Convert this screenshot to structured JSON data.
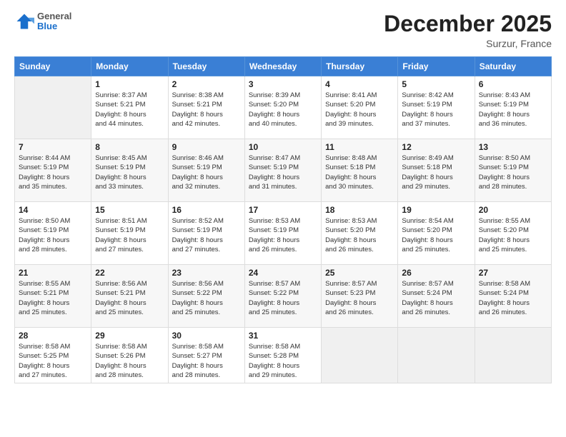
{
  "header": {
    "logo_general": "General",
    "logo_blue": "Blue",
    "month_title": "December 2025",
    "location": "Surzur, France"
  },
  "days_of_week": [
    "Sunday",
    "Monday",
    "Tuesday",
    "Wednesday",
    "Thursday",
    "Friday",
    "Saturday"
  ],
  "weeks": [
    [
      {
        "day": "",
        "info": ""
      },
      {
        "day": "1",
        "info": "Sunrise: 8:37 AM\nSunset: 5:21 PM\nDaylight: 8 hours\nand 44 minutes."
      },
      {
        "day": "2",
        "info": "Sunrise: 8:38 AM\nSunset: 5:21 PM\nDaylight: 8 hours\nand 42 minutes."
      },
      {
        "day": "3",
        "info": "Sunrise: 8:39 AM\nSunset: 5:20 PM\nDaylight: 8 hours\nand 40 minutes."
      },
      {
        "day": "4",
        "info": "Sunrise: 8:41 AM\nSunset: 5:20 PM\nDaylight: 8 hours\nand 39 minutes."
      },
      {
        "day": "5",
        "info": "Sunrise: 8:42 AM\nSunset: 5:19 PM\nDaylight: 8 hours\nand 37 minutes."
      },
      {
        "day": "6",
        "info": "Sunrise: 8:43 AM\nSunset: 5:19 PM\nDaylight: 8 hours\nand 36 minutes."
      }
    ],
    [
      {
        "day": "7",
        "info": "Sunrise: 8:44 AM\nSunset: 5:19 PM\nDaylight: 8 hours\nand 35 minutes."
      },
      {
        "day": "8",
        "info": "Sunrise: 8:45 AM\nSunset: 5:19 PM\nDaylight: 8 hours\nand 33 minutes."
      },
      {
        "day": "9",
        "info": "Sunrise: 8:46 AM\nSunset: 5:19 PM\nDaylight: 8 hours\nand 32 minutes."
      },
      {
        "day": "10",
        "info": "Sunrise: 8:47 AM\nSunset: 5:19 PM\nDaylight: 8 hours\nand 31 minutes."
      },
      {
        "day": "11",
        "info": "Sunrise: 8:48 AM\nSunset: 5:18 PM\nDaylight: 8 hours\nand 30 minutes."
      },
      {
        "day": "12",
        "info": "Sunrise: 8:49 AM\nSunset: 5:18 PM\nDaylight: 8 hours\nand 29 minutes."
      },
      {
        "day": "13",
        "info": "Sunrise: 8:50 AM\nSunset: 5:19 PM\nDaylight: 8 hours\nand 28 minutes."
      }
    ],
    [
      {
        "day": "14",
        "info": "Sunrise: 8:50 AM\nSunset: 5:19 PM\nDaylight: 8 hours\nand 28 minutes."
      },
      {
        "day": "15",
        "info": "Sunrise: 8:51 AM\nSunset: 5:19 PM\nDaylight: 8 hours\nand 27 minutes."
      },
      {
        "day": "16",
        "info": "Sunrise: 8:52 AM\nSunset: 5:19 PM\nDaylight: 8 hours\nand 27 minutes."
      },
      {
        "day": "17",
        "info": "Sunrise: 8:53 AM\nSunset: 5:19 PM\nDaylight: 8 hours\nand 26 minutes."
      },
      {
        "day": "18",
        "info": "Sunrise: 8:53 AM\nSunset: 5:20 PM\nDaylight: 8 hours\nand 26 minutes."
      },
      {
        "day": "19",
        "info": "Sunrise: 8:54 AM\nSunset: 5:20 PM\nDaylight: 8 hours\nand 25 minutes."
      },
      {
        "day": "20",
        "info": "Sunrise: 8:55 AM\nSunset: 5:20 PM\nDaylight: 8 hours\nand 25 minutes."
      }
    ],
    [
      {
        "day": "21",
        "info": "Sunrise: 8:55 AM\nSunset: 5:21 PM\nDaylight: 8 hours\nand 25 minutes."
      },
      {
        "day": "22",
        "info": "Sunrise: 8:56 AM\nSunset: 5:21 PM\nDaylight: 8 hours\nand 25 minutes."
      },
      {
        "day": "23",
        "info": "Sunrise: 8:56 AM\nSunset: 5:22 PM\nDaylight: 8 hours\nand 25 minutes."
      },
      {
        "day": "24",
        "info": "Sunrise: 8:57 AM\nSunset: 5:22 PM\nDaylight: 8 hours\nand 25 minutes."
      },
      {
        "day": "25",
        "info": "Sunrise: 8:57 AM\nSunset: 5:23 PM\nDaylight: 8 hours\nand 26 minutes."
      },
      {
        "day": "26",
        "info": "Sunrise: 8:57 AM\nSunset: 5:24 PM\nDaylight: 8 hours\nand 26 minutes."
      },
      {
        "day": "27",
        "info": "Sunrise: 8:58 AM\nSunset: 5:24 PM\nDaylight: 8 hours\nand 26 minutes."
      }
    ],
    [
      {
        "day": "28",
        "info": "Sunrise: 8:58 AM\nSunset: 5:25 PM\nDaylight: 8 hours\nand 27 minutes."
      },
      {
        "day": "29",
        "info": "Sunrise: 8:58 AM\nSunset: 5:26 PM\nDaylight: 8 hours\nand 28 minutes."
      },
      {
        "day": "30",
        "info": "Sunrise: 8:58 AM\nSunset: 5:27 PM\nDaylight: 8 hours\nand 28 minutes."
      },
      {
        "day": "31",
        "info": "Sunrise: 8:58 AM\nSunset: 5:28 PM\nDaylight: 8 hours\nand 29 minutes."
      },
      {
        "day": "",
        "info": ""
      },
      {
        "day": "",
        "info": ""
      },
      {
        "day": "",
        "info": ""
      }
    ]
  ]
}
